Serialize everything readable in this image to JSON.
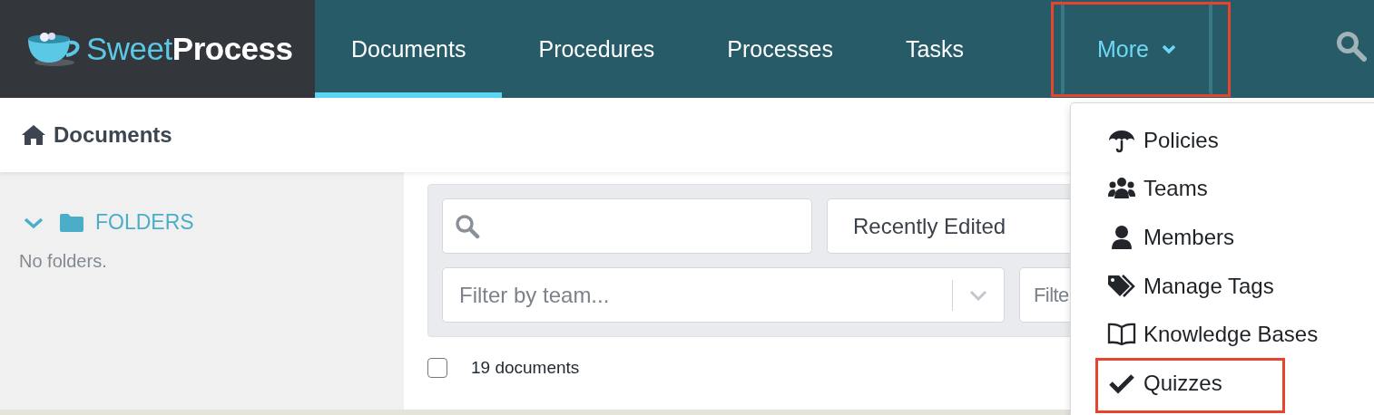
{
  "brand": {
    "light": "Sweet",
    "bold": "Process"
  },
  "nav": [
    {
      "label": "Documents",
      "selected": true,
      "highlighted": false,
      "kind": "link"
    },
    {
      "label": "Procedures",
      "selected": false,
      "highlighted": false,
      "kind": "link"
    },
    {
      "label": "Processes",
      "selected": false,
      "highlighted": false,
      "kind": "link"
    },
    {
      "label": "Tasks",
      "selected": false,
      "highlighted": false,
      "kind": "link"
    },
    {
      "label": "More",
      "selected": false,
      "highlighted": true,
      "kind": "dropdown",
      "expanded": true
    }
  ],
  "breadcrumb": "Documents",
  "sidebar": {
    "expanded": true,
    "title": "FOLDERS",
    "empty_text": "No folders."
  },
  "filters": {
    "sort": {
      "value": "Recently Edited"
    },
    "team": {
      "placeholder": "Filter by team..."
    },
    "filter_4": {
      "placeholder": "Filte"
    }
  },
  "list": {
    "checked": false,
    "count": "19 documents"
  },
  "menu": {
    "items": [
      {
        "label": "Policies",
        "highlighted": false
      },
      {
        "label": "Teams",
        "highlighted": false
      },
      {
        "label": "Members",
        "highlighted": false
      },
      {
        "label": "Manage Tags",
        "highlighted": false
      },
      {
        "label": "Knowledge Bases",
        "highlighted": false
      },
      {
        "label": "Quizzes",
        "highlighted": true
      }
    ]
  }
}
